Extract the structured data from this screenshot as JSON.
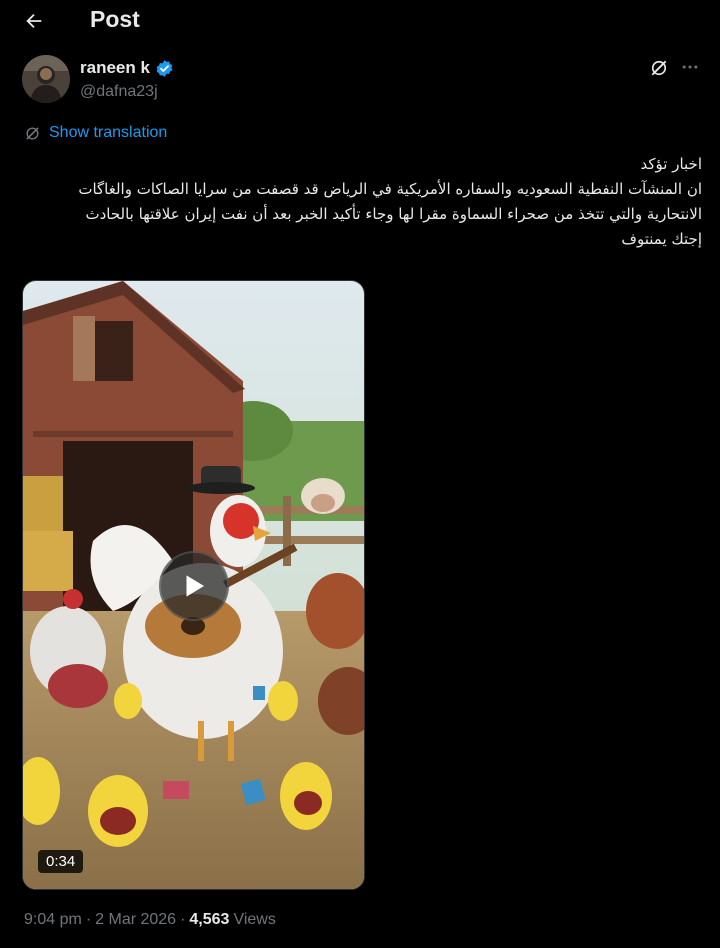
{
  "header": {
    "title": "Post"
  },
  "author": {
    "name": "raneen k",
    "handle": "@dafna23j"
  },
  "translate": {
    "label": "Show translation"
  },
  "post": {
    "lines": [
      "اخبار تؤكد",
      "ان المنشآت النفطية السعوديه والسفاره الأمريكية في الرياض قد قصفت من سرايا الصاكات والغاگات",
      "الانتحارية والتي تتخذ من صحراء السماوة مقرا لها وجاء تأكيد الخبر بعد أن نفت إيران علاقتها بالحادث",
      "إجتك يمنتوف"
    ]
  },
  "media": {
    "duration": "0:34"
  },
  "meta": {
    "time": "9:04 pm",
    "separator": "·",
    "date": "2 Mar 2026",
    "views_count": "4,563",
    "views_label": "Views"
  },
  "colors": {
    "accent": "#1d9bf0",
    "muted": "#71767b",
    "text": "#e7e9ea",
    "background": "#000000"
  },
  "icons": {
    "back": "arrow-left-icon",
    "verified": "verified-badge-icon",
    "grok": "grok-icon",
    "more": "more-icon",
    "translate": "translate-icon",
    "play": "play-icon"
  }
}
